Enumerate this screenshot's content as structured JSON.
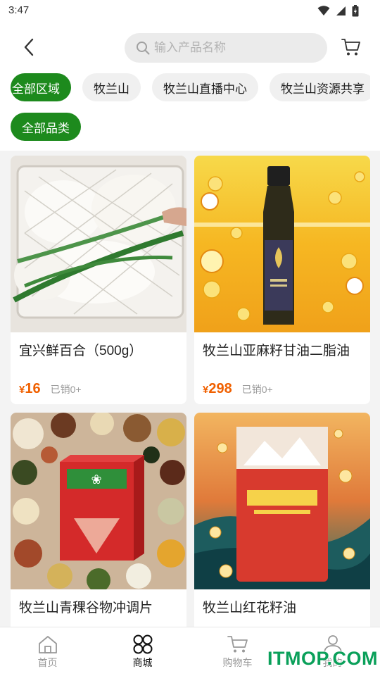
{
  "status_bar": {
    "time": "3:47"
  },
  "header": {
    "search_placeholder": "输入产品名称"
  },
  "filters": {
    "regions": [
      "全部区域",
      "牧兰山",
      "牧兰山直播中心",
      "牧兰山资源共享"
    ],
    "active_region": "全部区域",
    "category": "全部品类"
  },
  "products": [
    {
      "name": "宜兴鲜百合（500g）",
      "currency": "¥",
      "price": "16",
      "sold": "已销0+"
    },
    {
      "name": "牧兰山亚麻籽甘油二脂油",
      "currency": "¥",
      "price": "298",
      "sold": "已销0+"
    },
    {
      "name": "牧兰山青稞谷物冲调片"
    },
    {
      "name": "牧兰山红花籽油"
    }
  ],
  "tabbar": {
    "items": [
      {
        "label": "首页",
        "icon": "home-icon"
      },
      {
        "label": "商城",
        "icon": "grid-icon"
      },
      {
        "label": "购物车",
        "icon": "cart-icon"
      },
      {
        "label": "我的",
        "icon": "user-icon"
      }
    ],
    "active_index": 1
  },
  "watermark": "ITMOP.COM",
  "colors": {
    "accent_green": "#1d8a1d",
    "price_orange": "#f06000",
    "watermark_green": "#0aa05a"
  }
}
